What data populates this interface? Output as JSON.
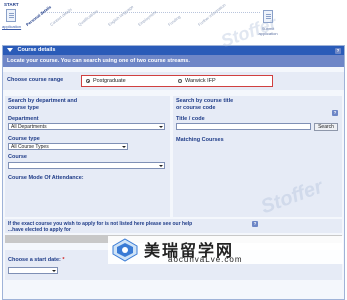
{
  "progress": {
    "start_label": "START",
    "application_label": "application",
    "steps": [
      "Personal details",
      "Contact details",
      "Qualifications",
      "English language",
      "Employment",
      "Funding",
      "Further information"
    ],
    "submit_label": "Submit application"
  },
  "panel": {
    "title": "Course details",
    "intro": "Locate your course. You can search using one of two course streams.",
    "course_range": {
      "label": "Choose course range",
      "options": [
        "Postgraduate",
        "Warwick IFP"
      ],
      "selected": "Postgraduate"
    },
    "left": {
      "title_line1": "Search by department and",
      "title_line2": "course type",
      "department_label": "Department",
      "department_value": "All Departments",
      "course_type_label": "Course type",
      "course_type_value": "All Course Types",
      "course_label": "Course",
      "course_value": "",
      "mode_label": "Course Mode Of Attendance:"
    },
    "right": {
      "title_line1": "Search by course title",
      "title_line2": "or course code",
      "title_code_label": "Title / code",
      "search_button": "Search",
      "matching_label": "Matching Courses"
    },
    "bottom_note_line1": "If the exact course you wish to apply for is not listed here please see our help",
    "bottom_note_line2": "...have elected to apply for",
    "start_date_label": "Choose a start date:",
    "start_date_required": "*"
  },
  "watermark": "Stoffer",
  "logo": {
    "name": "美瑞留学网",
    "url": "aocunvaLve.com"
  },
  "colors": {
    "header_blue": "#2a5bb8",
    "intro_blue": "#6e86c7",
    "highlight_red": "#d04040"
  }
}
